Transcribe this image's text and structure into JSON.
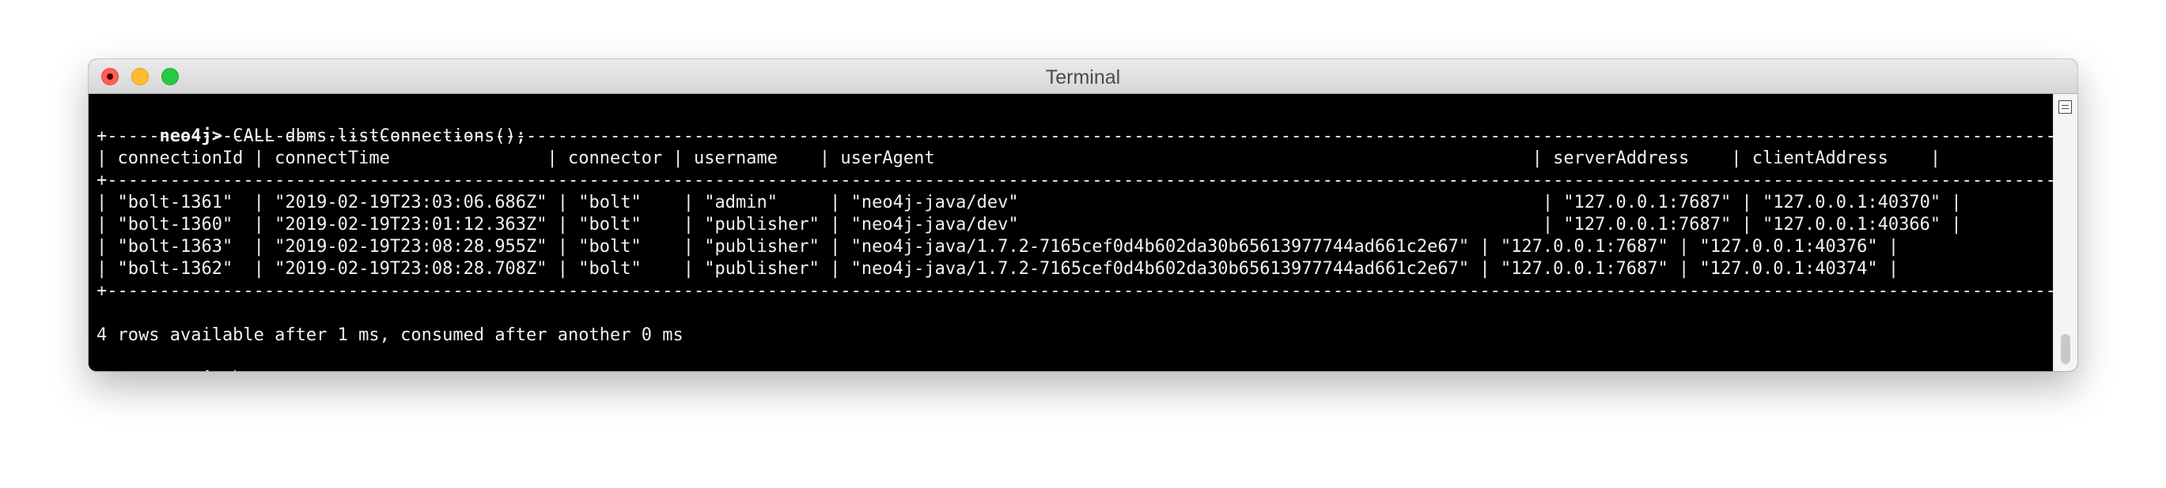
{
  "window": {
    "title": "Terminal"
  },
  "terminal": {
    "prompt": "neo4j>",
    "command": " CALL dbms.listConnections();",
    "separator": "+--------------------------------------------------------------------------------------------------------------------------------------------------------------------------------------------------+",
    "header": "| connectionId | connectTime               | connector | username    | userAgent                                                         | serverAddress    | clientAddress    |",
    "rows": [
      "| \"bolt-1361\"  | \"2019-02-19T23:03:06.686Z\" | \"bolt\"    | \"admin\"     | \"neo4j-java/dev\"                                                  | \"127.0.0.1:7687\" | \"127.0.0.1:40370\" |",
      "| \"bolt-1360\"  | \"2019-02-19T23:01:12.363Z\" | \"bolt\"    | \"publisher\" | \"neo4j-java/dev\"                                                  | \"127.0.0.1:7687\" | \"127.0.0.1:40366\" |",
      "| \"bolt-1363\"  | \"2019-02-19T23:08:28.955Z\" | \"bolt\"    | \"publisher\" | \"neo4j-java/1.7.2-7165cef0d4b602da30b65613977744ad661c2e67\" | \"127.0.0.1:7687\" | \"127.0.0.1:40376\" |",
      "| \"bolt-1362\"  | \"2019-02-19T23:08:28.708Z\" | \"bolt\"    | \"publisher\" | \"neo4j-java/1.7.2-7165cef0d4b602da30b65613977744ad661c2e67\" | \"127.0.0.1:7687\" | \"127.0.0.1:40374\" |"
    ],
    "summary": "4 rows available after 1 ms, consumed after another 0 ms"
  },
  "colors": {
    "terminal_bg": "#000000",
    "terminal_fg": "#f2f2f2",
    "close": "#fe5f57",
    "minimize": "#febc2e",
    "maximize": "#28c840"
  },
  "icons": {
    "close": "close-icon",
    "minimize": "minimize-icon",
    "maximize": "maximize-icon",
    "scrollbar_button": "hamburger-icon"
  }
}
